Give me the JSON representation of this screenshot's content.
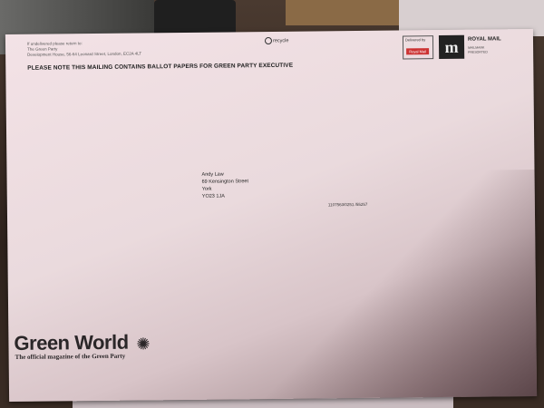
{
  "envelope": {
    "return_address_lines": [
      "If undelivered please return to:",
      "The Green Party",
      "Development House, 56-64 Leonard Street, London, EC2A 4LT"
    ],
    "notice": "PLEASE NOTE THIS MAILING CONTAINS BALLOT PAPERS FOR GREEN PARTY EXECUTIVE",
    "recycle_label": "recycle",
    "postage": {
      "delivered_by": "Delivered by",
      "carrier_badge": "Royal Mail",
      "royal_mail_text": "ROYAL MAIL",
      "royal_mail_logo": "m",
      "royal_mail_sub": [
        "MAILMARK",
        "PRESORTED"
      ]
    },
    "recipient": {
      "lines": [
        "Andy Law",
        "69 Kensington Street",
        "York",
        "YO23 1JA"
      ]
    },
    "barcode_number": "1107563/0251 /55257",
    "magazine": {
      "title": "Green World",
      "sun_icon": "sun-icon",
      "subtitle": "The official magazine of the Green Party"
    }
  }
}
